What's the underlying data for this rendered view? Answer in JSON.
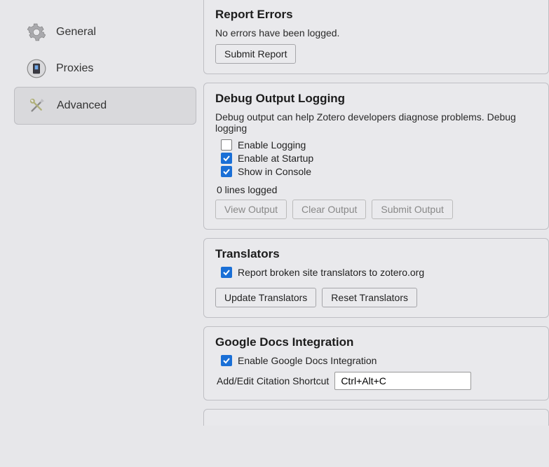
{
  "sidebar": {
    "items": [
      {
        "label": "General",
        "icon": "gear-icon",
        "selected": false
      },
      {
        "label": "Proxies",
        "icon": "proxy-icon",
        "selected": false
      },
      {
        "label": "Advanced",
        "icon": "tools-icon",
        "selected": true
      }
    ]
  },
  "report_errors": {
    "title": "Report Errors",
    "status": "No errors have been logged.",
    "submit_label": "Submit Report"
  },
  "debug": {
    "title": "Debug Output Logging",
    "desc": "Debug output can help Zotero developers diagnose problems. Debug logging",
    "enable_logging": {
      "label": "Enable Logging",
      "checked": false
    },
    "enable_startup": {
      "label": "Enable at Startup",
      "checked": true
    },
    "show_console": {
      "label": "Show in Console",
      "checked": true
    },
    "lines_logged": "0 lines logged",
    "view_label": "View Output",
    "clear_label": "Clear Output",
    "submit_label": "Submit Output"
  },
  "translators": {
    "title": "Translators",
    "report_broken": {
      "label": "Report broken site translators to zotero.org",
      "checked": true
    },
    "update_label": "Update Translators",
    "reset_label": "Reset Translators"
  },
  "gdocs": {
    "title": "Google Docs Integration",
    "enable": {
      "label": "Enable Google Docs Integration",
      "checked": true
    },
    "shortcut_label": "Add/Edit Citation Shortcut",
    "shortcut_value": "Ctrl+Alt+C"
  }
}
